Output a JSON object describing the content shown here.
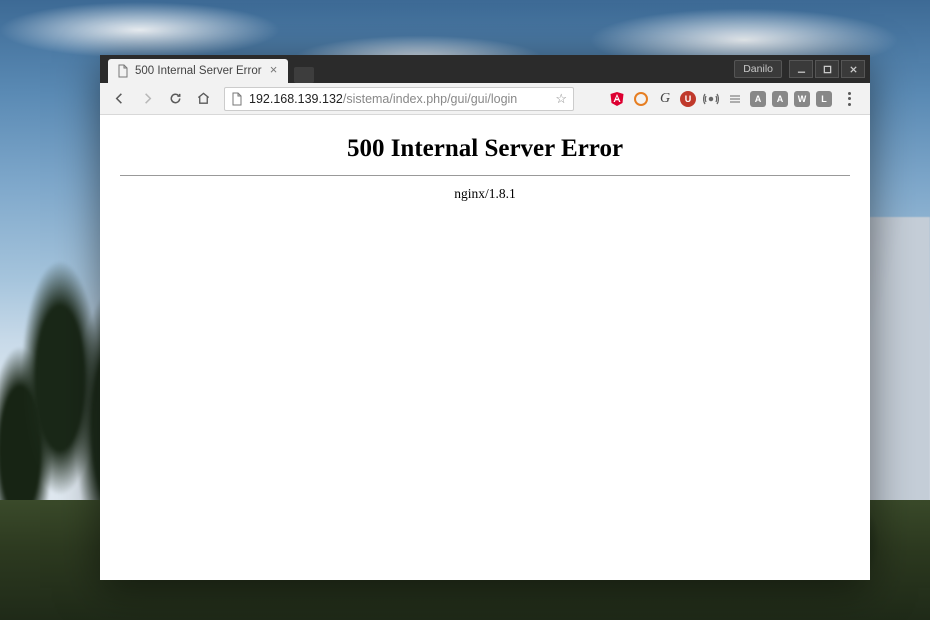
{
  "titlebar": {
    "user_label": "Danilo"
  },
  "tab": {
    "title": "500 Internal Server Error"
  },
  "address": {
    "host": "192.168.139.132",
    "path": "/sistema/index.php/gui/gui/login"
  },
  "extensions": {
    "angular": "A",
    "g_icon": "G",
    "u_block": "U",
    "sq_a": "A",
    "sq_a2": "A",
    "sq_w": "W",
    "sq_l": "L"
  },
  "page": {
    "heading": "500 Internal Server Error",
    "server": "nginx/1.8.1"
  }
}
